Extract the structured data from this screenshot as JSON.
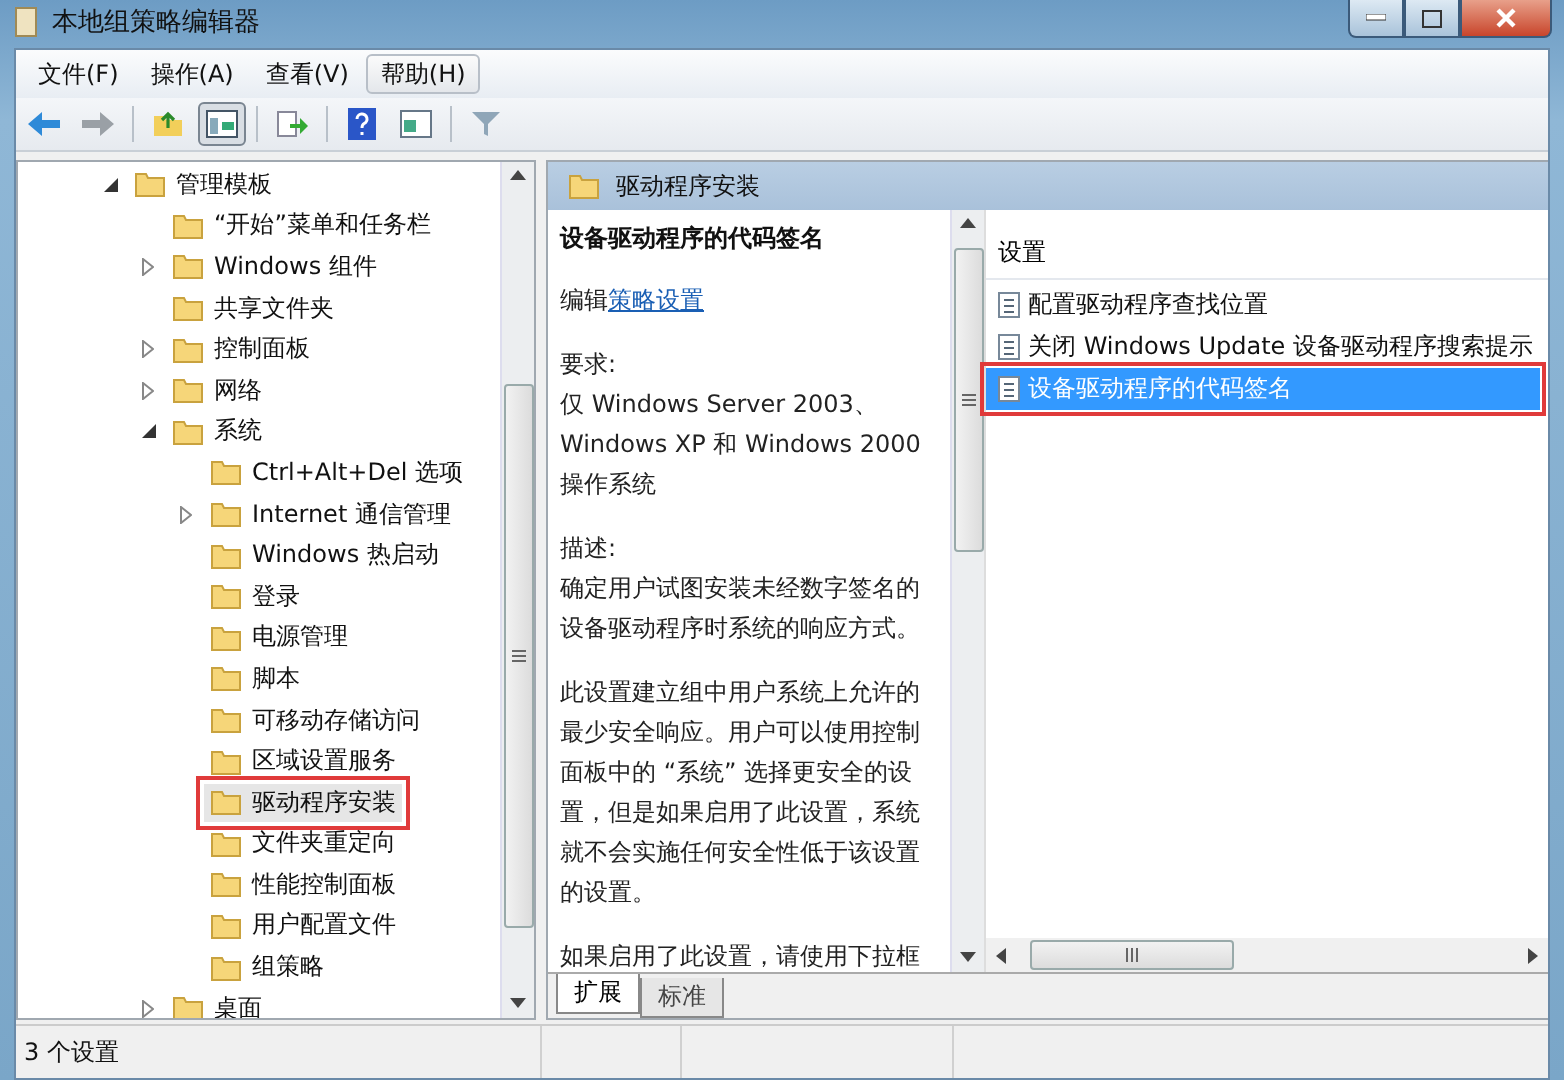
{
  "window": {
    "title": "本地组策略编辑器"
  },
  "menu": [
    {
      "label": "文件(F)",
      "selected": false
    },
    {
      "label": "操作(A)",
      "selected": false
    },
    {
      "label": "查看(V)",
      "selected": false
    },
    {
      "label": "帮助(H)",
      "selected": true
    }
  ],
  "tree": [
    {
      "label": "管理模板",
      "expanded": true,
      "selected": false,
      "annotated": false,
      "children": [
        {
          "label": "“开始”菜单和任务栏",
          "selected": false,
          "annotated": false
        },
        {
          "label": "Windows 组件",
          "expanded": false,
          "selected": false,
          "annotated": false
        },
        {
          "label": "共享文件夹",
          "selected": false,
          "annotated": false
        },
        {
          "label": "控制面板",
          "expanded": false,
          "selected": false,
          "annotated": false
        },
        {
          "label": "网络",
          "expanded": false,
          "selected": false,
          "annotated": false
        },
        {
          "label": "系统",
          "expanded": true,
          "selected": false,
          "annotated": false,
          "children": [
            {
              "label": "Ctrl+Alt+Del 选项",
              "selected": false,
              "annotated": false
            },
            {
              "label": "Internet 通信管理",
              "expanded": false,
              "selected": false,
              "annotated": false
            },
            {
              "label": "Windows 热启动",
              "selected": false,
              "annotated": false
            },
            {
              "label": "登录",
              "selected": false,
              "annotated": false
            },
            {
              "label": "电源管理",
              "selected": false,
              "annotated": false
            },
            {
              "label": "脚本",
              "selected": false,
              "annotated": false
            },
            {
              "label": "可移动存储访问",
              "selected": false,
              "annotated": false
            },
            {
              "label": "区域设置服务",
              "selected": false,
              "annotated": false
            },
            {
              "label": "驱动程序安装",
              "selected": true,
              "annotated": true
            },
            {
              "label": "文件夹重定向",
              "selected": false,
              "annotated": false
            },
            {
              "label": "性能控制面板",
              "selected": false,
              "annotated": false
            },
            {
              "label": "用户配置文件",
              "selected": false,
              "annotated": false
            },
            {
              "label": "组策略",
              "selected": false,
              "annotated": false
            }
          ]
        },
        {
          "label": "桌面",
          "expanded": false,
          "selected": false,
          "annotated": false
        }
      ]
    }
  ],
  "detail": {
    "header": "驱动程序安装",
    "policy_title": "设备驱动程序的代码签名",
    "edit_prefix": "编辑",
    "edit_link": "策略设置",
    "paragraphs": [
      "要求:\n仅 Windows Server 2003、Windows XP 和 Windows 2000 操作系统",
      "描述:\n确定用户试图安装未经数字签名的设备驱动程序时系统的响应方式。",
      "此设置建立组中用户系统上允许的最少安全响应。用户可以使用控制面板中的 “系统” 选择更安全的设置，但是如果启用了此设置，系统就不会实施任何安全性低于该设置的设置。",
      "如果启用了此设置，请使用下拉框"
    ],
    "tabs": [
      {
        "label": "扩展",
        "selected": true
      },
      {
        "label": "标准",
        "selected": false
      }
    ]
  },
  "settings": {
    "column": "设置",
    "rows": [
      {
        "label": "配置驱动程序查找位置",
        "selected": false,
        "annotated": false
      },
      {
        "label": "关闭 Windows Update 设备驱动程序搜索提示",
        "selected": false,
        "annotated": false
      },
      {
        "label": "设备驱动程序的代码签名",
        "selected": true,
        "annotated": true
      }
    ]
  },
  "status_bar": "3 个设置"
}
